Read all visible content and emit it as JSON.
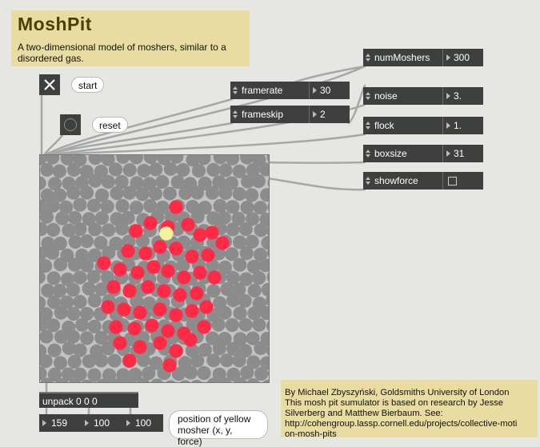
{
  "title": "MoshPit",
  "subtitle": "A two-dimensional model of moshers, similar to a disordered gas.",
  "controls": {
    "start_label": "start",
    "reset_label": "reset"
  },
  "attributes": {
    "numMoshers": {
      "label": "numMoshers",
      "value": "300"
    },
    "framerate": {
      "label": "framerate",
      "value": "30"
    },
    "frameskip": {
      "label": "frameskip",
      "value": "2"
    },
    "noise": {
      "label": "noise",
      "value": "3."
    },
    "flock": {
      "label": "flock",
      "value": "1."
    },
    "boxsize": {
      "label": "boxsize",
      "value": "31"
    },
    "showforce": {
      "label": "showforce",
      "checked": false
    }
  },
  "unpack": {
    "label": "unpack 0 0 0"
  },
  "outputs": {
    "x": "159",
    "y": "100",
    "force": "100",
    "description": "position of yellow mosher (x, y, force)"
  },
  "credits": [
    "By Michael Zbyszyński, Goldsmiths University of London",
    "This mosh pit sumulator is based on research by Jesse",
    "Silverberg and Matthew Bierbaum. See:",
    "http://cohengroup.lassp.cornell.edu/projects/collective-moti",
    "on-mosh-pits"
  ],
  "colors": {
    "passive_mosher": "#8c8c8c",
    "active_mosher": "#ff2a45",
    "tracked_mosher": "#f4f29a",
    "object_bg": "#3e4040",
    "panel_bg": "#e8dca0"
  }
}
